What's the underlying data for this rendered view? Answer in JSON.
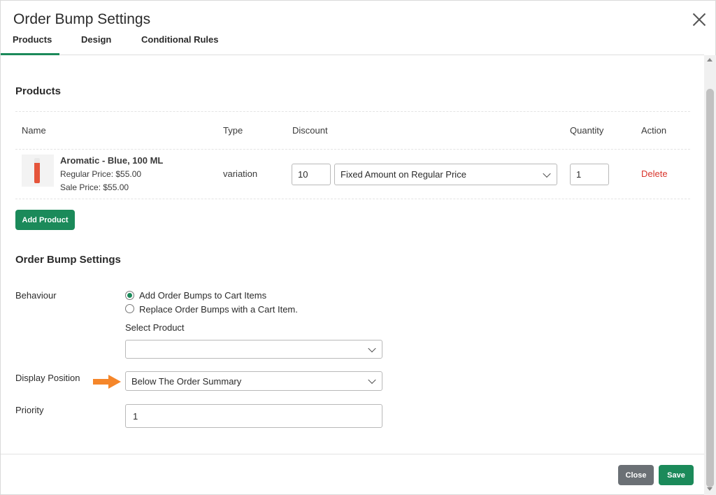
{
  "modal": {
    "title": "Order Bump Settings"
  },
  "tabs": [
    {
      "label": "Products",
      "active": true
    },
    {
      "label": "Design",
      "active": false
    },
    {
      "label": "Conditional Rules",
      "active": false
    }
  ],
  "products_section": {
    "title": "Products",
    "columns": [
      "Name",
      "Type",
      "Discount",
      "Quantity",
      "Action"
    ],
    "rows": [
      {
        "name": "Aromatic - Blue, 100 ML",
        "regular_price": "Regular Price: $55.00",
        "sale_price": "Sale Price: $55.00",
        "type": "variation",
        "discount_value": "10",
        "discount_type": "Fixed Amount on Regular Price",
        "quantity": "1",
        "action": "Delete"
      }
    ],
    "add_button": "Add Product"
  },
  "settings_section": {
    "title": "Order Bump Settings",
    "behaviour_label": "Behaviour",
    "behaviour_options": [
      {
        "label": "Add Order Bumps to Cart Items",
        "checked": true
      },
      {
        "label": "Replace Order Bumps with a Cart Item.",
        "checked": false
      }
    ],
    "select_product_label": "Select Product",
    "select_product_value": "",
    "display_position_label": "Display Position",
    "display_position_value": "Below The Order Summary",
    "priority_label": "Priority",
    "priority_value": "1"
  },
  "footer": {
    "close_label": "Close",
    "save_label": "Save"
  },
  "colors": {
    "accent": "#1b8a5a",
    "danger": "#d9342b",
    "arrow": "#f5862a",
    "close_button": "#6b7075"
  },
  "icons": [
    "close-icon",
    "chevron-down-icon",
    "arrow-right-icon",
    "product-bottle-icon"
  ]
}
